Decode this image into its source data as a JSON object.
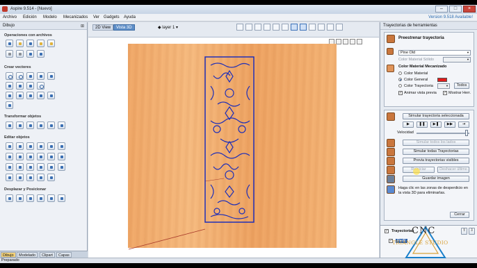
{
  "app": {
    "title": "Aspire 9.514 - [Nuevo]",
    "version": "Version 9.518 Available!",
    "status": "Preparado"
  },
  "menu": [
    "Archivo",
    "Edición",
    "Modelo",
    "Mecanizados",
    "Ver",
    "Gadgets",
    "Ayuda"
  ],
  "left_panel": {
    "header": "Dibujo",
    "sections": [
      "Operaciones con archivos",
      "Crear vectores",
      "Transformar objetos",
      "Editar objetos",
      "Desplazar y Posicionar"
    ],
    "tabs": [
      "Dibujo",
      "Modelado",
      "Clipart",
      "Capas"
    ]
  },
  "view": {
    "tabs": [
      "2D View",
      "Vista 3D"
    ],
    "layer": "layer 1"
  },
  "right_panel": {
    "header": "Trayectorias de herramientas",
    "title": "Preestrenar trayectoria",
    "material": "Pine Old",
    "color_material_solido": "Color Material Sólido",
    "color_material_mecanizado": "Color Material Mecanizado",
    "radio_color_material": "Color Material",
    "radio_color_general": "Color General",
    "radio_color_trayectoria": "Color Trayectoria",
    "btn_todos": "Todos",
    "chk_animar": "Animar vista previa",
    "chk_mostrar": "Mostrar Herr.",
    "btn_simular_sel": "Simular trayectoria seleccionada",
    "velocidad": "Velocidad",
    "btn_simular_lados": "Simular todos los lados",
    "btn_simular_todas": "Simular todas Trayectorias",
    "btn_previa": "Previa trayectorias visibles",
    "btn_reiniciar": "Reiniciar",
    "btn_deshacer": "Deshacer último",
    "btn_guardar": "Guardar imagen",
    "hint": "Haga clic en las zonas de desperdicio en la vista 3D para eliminarlas.",
    "btn_cerrar": "Cerrar",
    "trayectorias_label": "Trayectorias",
    "perfil_label": "Perfil"
  },
  "watermark": {
    "line1": "CNC",
    "line2": "TRIANGLE STUDIO"
  },
  "colors": {
    "wood": "#f4b476",
    "vector": "#1f2fb8",
    "general_color": "#e21b1b",
    "active_tab": "#5f8fc8"
  }
}
